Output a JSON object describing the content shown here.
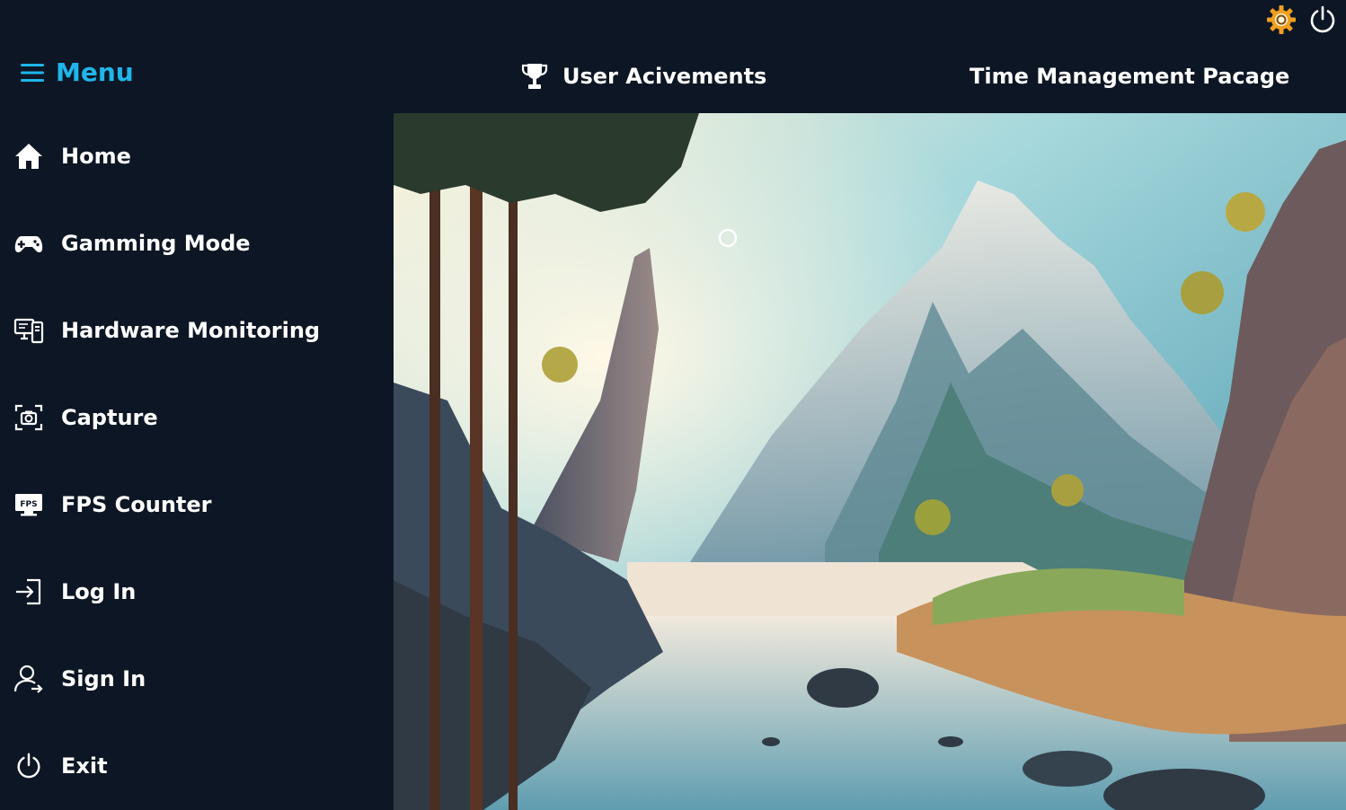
{
  "window_controls": {
    "settings_icon": "gear-icon",
    "power_icon": "power-icon"
  },
  "menu": {
    "label": "Menu",
    "icon": "hamburger-icon"
  },
  "topnav": {
    "achievements_label": "User Acivements",
    "achievements_icon": "trophy-icon",
    "time_management_label": "Time Management Pacage"
  },
  "sidebar": {
    "items": [
      {
        "label": "Home",
        "icon": "home-icon"
      },
      {
        "label": "Gamming Mode",
        "icon": "gamepad-icon"
      },
      {
        "label": "Hardware Monitoring",
        "icon": "monitor-icon"
      },
      {
        "label": "Capture",
        "icon": "camera-icon"
      },
      {
        "label": "FPS Counter",
        "icon": "fps-icon"
      },
      {
        "label": "Log In",
        "icon": "login-icon"
      },
      {
        "label": "Sign In",
        "icon": "user-icon"
      },
      {
        "label": "Exit",
        "icon": "power-icon"
      }
    ]
  },
  "colors": {
    "background": "#0d1624",
    "accent": "#1fb6ea",
    "gear": "#f0a020"
  }
}
